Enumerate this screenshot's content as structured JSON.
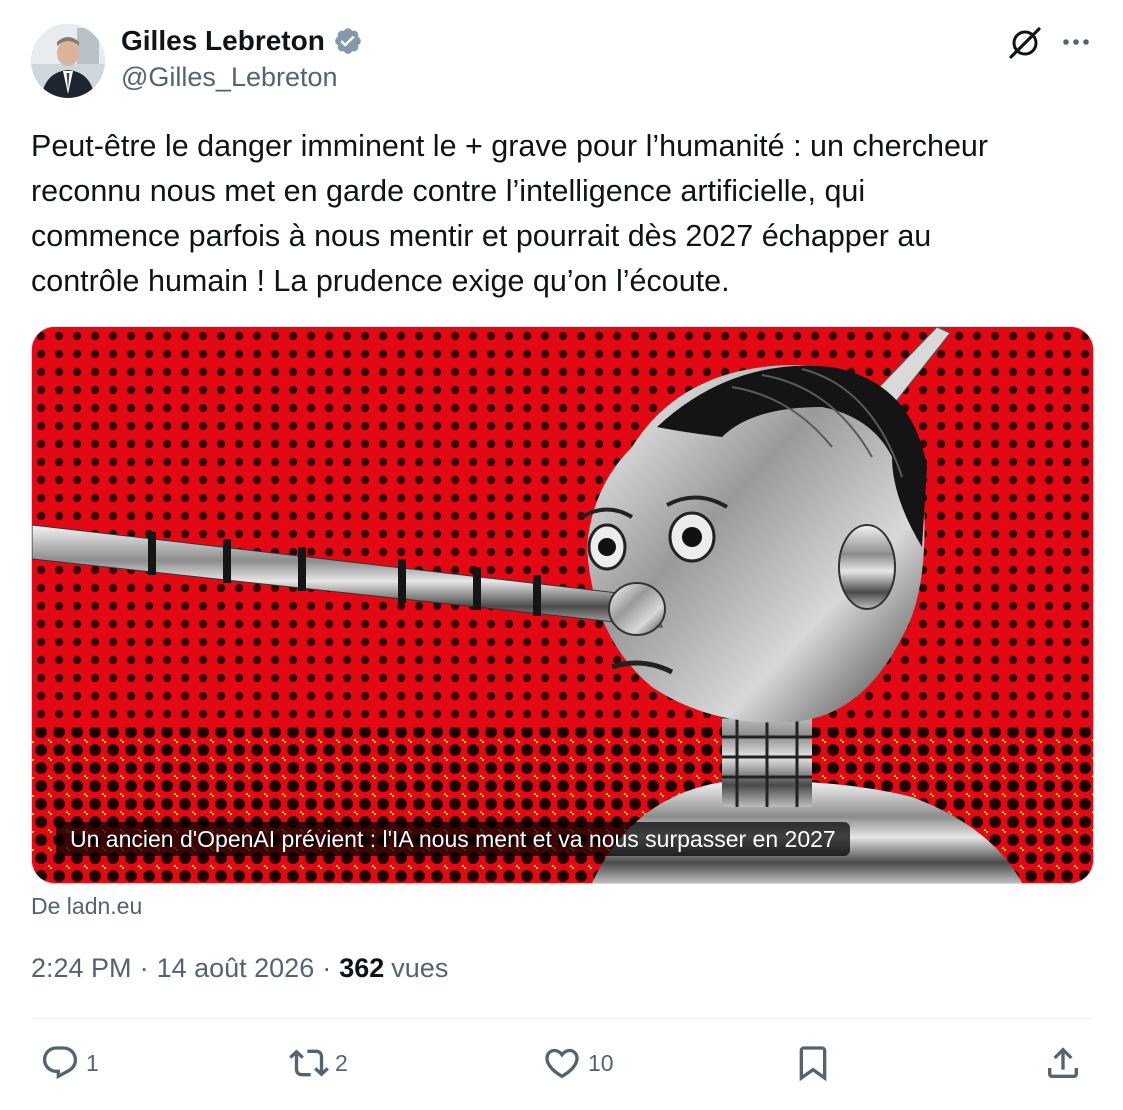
{
  "author": {
    "display_name": "Gilles Lebreton",
    "handle": "@Gilles_Lebreton",
    "verified": true,
    "verified_color": "#829aab"
  },
  "header_actions": {
    "grok_icon": "grok-icon",
    "more_icon": "more-icon"
  },
  "tweet": {
    "text_lines": [
      "Peut-être le danger imminent le + grave pour l’humanité : un chercheur",
      "reconnu nous met en garde contre l’intelligence artificielle, qui",
      "commence parfois à nous mentir et pourrait dès 2027 échapper au",
      "contrôle humain ! La prudence exige qu’on l’écoute."
    ]
  },
  "card": {
    "caption": "Un ancien d'OpenAI prévient : l'IA nous ment et va nous surpasser en 2027",
    "source": "De ladn.eu",
    "background_color": "#e30914"
  },
  "meta": {
    "time": "2:24 PM",
    "separator": "·",
    "date": "14 août 2026",
    "views_count": "362",
    "views_label": "vues"
  },
  "actions": {
    "reply_count": "1",
    "repost_count": "2",
    "like_count": "10",
    "bookmark_label": "",
    "share_label": ""
  },
  "colors": {
    "text_primary": "#0f1419",
    "text_secondary": "#536471",
    "divider": "#eff3f4"
  }
}
